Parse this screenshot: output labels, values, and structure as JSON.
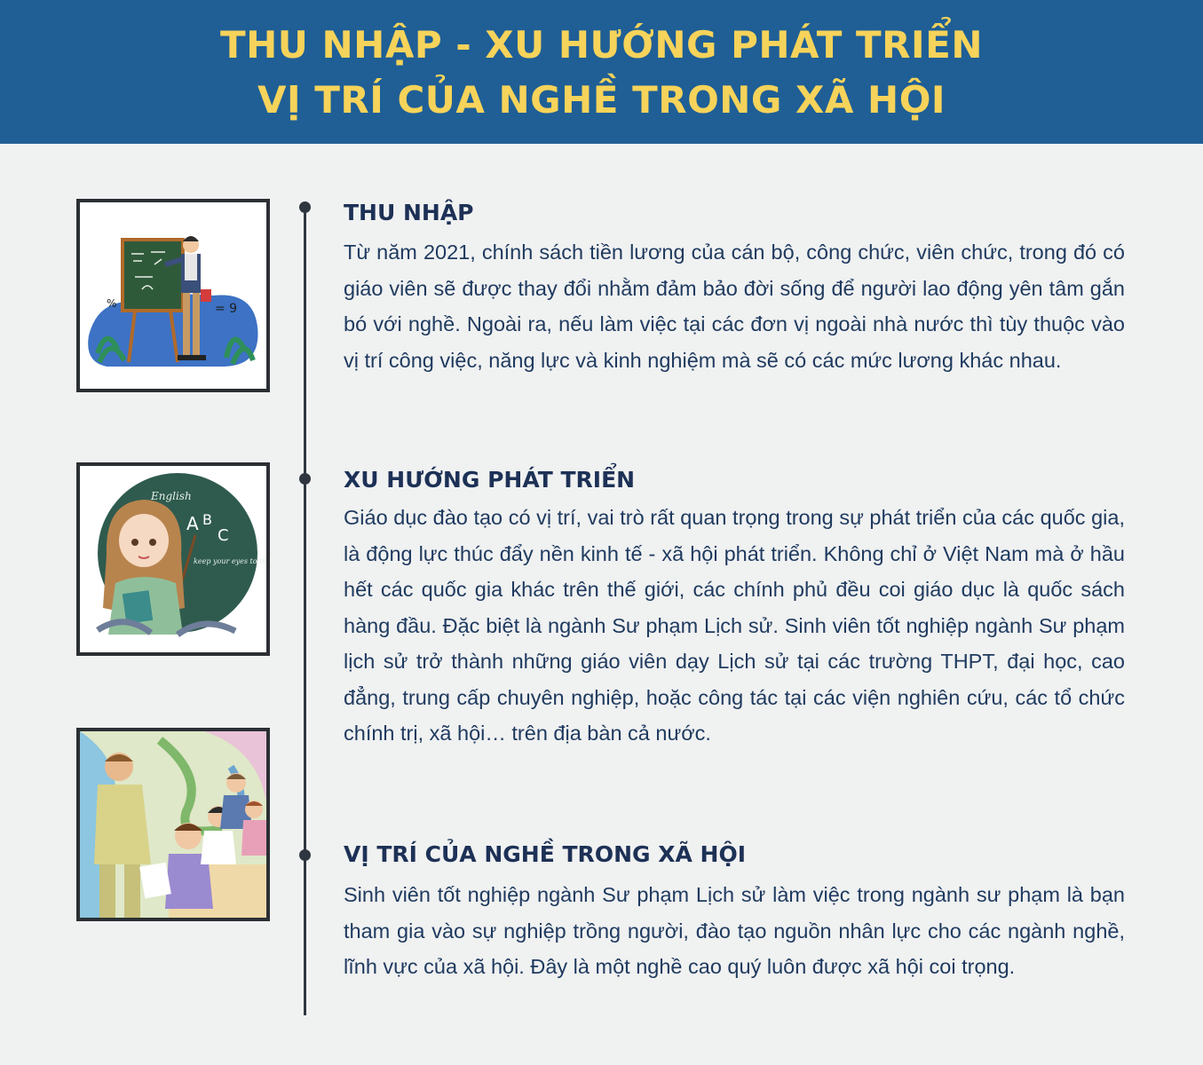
{
  "banner": {
    "title_line1": "THU NHẬP - XU HƯỚNG PHÁT TRIỂN",
    "title_line2": "VỊ TRÍ CỦA NGHỀ TRONG XÃ HỘI"
  },
  "sections": [
    {
      "heading": "THU NHẬP",
      "text": "Từ năm 2021, chính sách tiền lương của cán bộ, công chức, viên chức, trong đó có giáo viên sẽ được thay đổi nhằm đảm bảo đời sống để người lao động yên tâm gắn bó với nghề. Ngoài ra, nếu làm việc tại các đơn vị ngoài nhà nước thì tùy thuộc vào vị trí công việc, năng lực và kinh nghiệm mà sẽ có các mức lương khác nhau."
    },
    {
      "heading": "XU HƯỚNG PHÁT TRIỂN",
      "text": "Giáo dục đào tạo có vị trí, vai trò rất quan trọng trong sự phát triển của các quốc gia, là động lực thúc đẩy nền kinh tế - xã hội phát triển. Không chỉ ở Việt Nam mà ở hầu hết các quốc gia khác trên thế giới, các chính phủ đều coi giáo dục là quốc sách hàng đầu. Đặc biệt là ngành Sư phạm Lịch sử. Sinh viên tốt nghiệp ngành Sư phạm lịch sử trở thành những giáo viên dạy Lịch sử tại các trường THPT, đại học, cao đẳng, trung cấp chuyên nghiệp, hoặc công tác tại các viện nghiên cứu, các tổ chức chính trị, xã hội… trên địa bàn cả nước."
    },
    {
      "heading": "VỊ TRÍ CỦA NGHỀ TRONG XÃ HỘI",
      "text": "Sinh viên tốt nghiệp ngành Sư phạm Lịch sử  làm việc trong ngành sư phạm là bạn tham gia vào sự nghiệp trồng người, đào tạo nguồn nhân lực cho các ngành nghề, lĩnh vực của xã hội. Đây là một nghề cao quý luôn được xã hội coi trọng."
    }
  ],
  "illustrations": {
    "chalkboard_text": "= 9",
    "board_word_1": "English",
    "board_letters_a": "A",
    "board_letters_b": "B",
    "board_letters_c": "C",
    "board_phrase": "keep your eyes to the sunshine"
  },
  "colors": {
    "banner": "#1f5f96",
    "banner_text": "#f6d35a",
    "heading": "#1d3156",
    "body_text": "#1e3a5f",
    "background": "#f0f1f1"
  }
}
